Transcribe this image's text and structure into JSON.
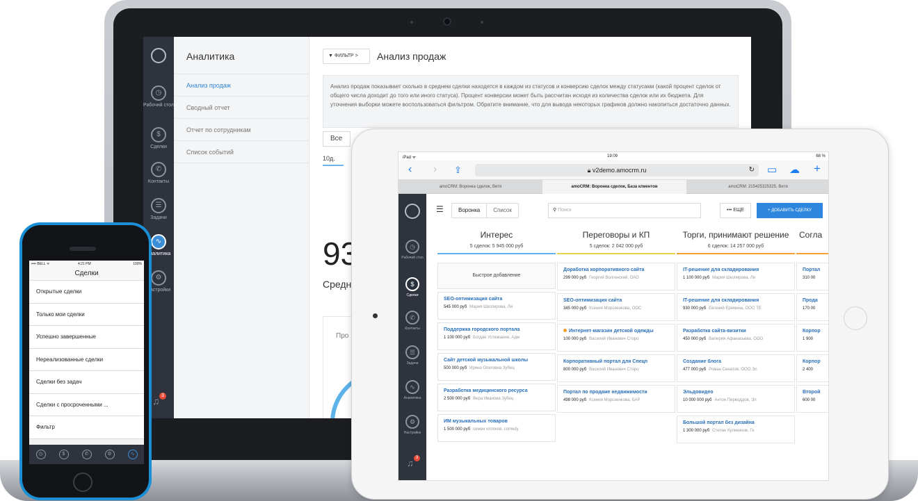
{
  "laptop": {
    "nav": {
      "items": [
        {
          "label": "Рабочий стол",
          "icon": "dashboard-icon"
        },
        {
          "label": "Сделки",
          "icon": "dollar-icon"
        },
        {
          "label": "Контакты",
          "icon": "phone-icon"
        },
        {
          "label": "Задачи",
          "icon": "tasks-icon"
        },
        {
          "label": "Аналитика",
          "icon": "analytics-icon"
        },
        {
          "label": "Настройки",
          "icon": "gear-icon"
        }
      ],
      "badge": "3"
    },
    "sidebar": {
      "title": "Аналитика",
      "items": [
        "Анализ продаж",
        "Сводный отчет",
        "Отчет по сотрудникам",
        "Список событий"
      ]
    },
    "main": {
      "filter_label": "ФИЛЬТР >",
      "title": "Анализ продаж",
      "description": "Анализ продаж показывает сколько в среднем сделки находятся в каждом из статусов и конверсию сделок между статусами (какой процент сделок от общего числа доходит до того или иного статуса). Процент конверсии может быть рассчитан исходя из количества сделок или их бюджета. Для уточнения выборки можете воспользоваться фильтром. Обратите внимание, что для вывода некоторых графиков должно накопиться достаточно данных.",
      "select_value": "Все",
      "tab": "10д.",
      "big_number": "93",
      "big_label": "Средн",
      "panel_label": "Про"
    }
  },
  "ipad": {
    "status": {
      "carrier": "iPad ᯤ",
      "time": "19:09",
      "battery": "68 %"
    },
    "url": "v2demo.amocrm.ru",
    "tabs": [
      "amoCRM: Воронка сделок, Витя",
      "amoCRM: Воронка сделок, База клиентов",
      "amoCRM: 215425325325, Витя"
    ],
    "nav": {
      "items": [
        {
          "label": "Рабочий стол",
          "icon": "dashboard-icon"
        },
        {
          "label": "Сделки",
          "icon": "dollar-icon"
        },
        {
          "label": "Контакты",
          "icon": "phone-icon"
        },
        {
          "label": "Задачи",
          "icon": "tasks-icon"
        },
        {
          "label": "Аналитика",
          "icon": "analytics-icon"
        },
        {
          "label": "Настройки",
          "icon": "gear-icon"
        }
      ],
      "badge": "3"
    },
    "toolbar": {
      "view_funnel": "Воронка",
      "view_list": "Список",
      "search_placeholder": "Поиск",
      "more": "ЕЩЕ",
      "add": "+ ДОБАВИТЬ СДЕЛКУ"
    },
    "quick_add": "Быстрое добавление",
    "columns": [
      {
        "title": "Интерес",
        "summary": "5 сделок: 5 945 000 руб",
        "color": "#5db2ea",
        "cards": [
          {
            "title": "SEO-оптимизация сайта",
            "price": "545 000 руб",
            "who": "Мария Шкопирова, Ли"
          },
          {
            "title": "Поддержка городского портала",
            "price": "1 100 000 руб",
            "who": "Богдан Устюжанин, Адм"
          },
          {
            "title": "Сайт детской музыкальной школы",
            "price": "500 000 руб",
            "who": "Ирина Олеговна Зубец"
          },
          {
            "title": "Разработка медицинского ресурса",
            "price": "2 500 000 руб",
            "who": "Вера Иванова Зубец"
          },
          {
            "title": "ИМ музыкальных товаров",
            "price": "1 500 000 руб",
            "who": "семен хлопков, comedy"
          }
        ]
      },
      {
        "title": "Переговоры и КП",
        "summary": "5 сделок: 2 042 000 руб",
        "color": "#e8d44a",
        "cards": [
          {
            "title": "Доработка корпоративного сайта",
            "price": "299 000 руб",
            "who": "Георгий Волгенский, ОАО"
          },
          {
            "title": "SEO-оптимизация сайта",
            "price": "345 000 руб",
            "who": "Ксения Морозенкова, ООС"
          },
          {
            "title": "Интернет-магазин детской одежды",
            "price": "100 000 руб",
            "who": "Василий Иванович Сторо",
            "dot": true
          },
          {
            "title": "Корпоративный портал для Спецп",
            "price": "800 000 руб",
            "who": "Василий Иванович Сторо"
          },
          {
            "title": "Портал по продаже недвижимости",
            "price": "498 000 руб",
            "who": "Ксения Морозенкова, БАР"
          }
        ]
      },
      {
        "title": "Торги, принимают решение",
        "summary": "6 сделок: 14 257 000 руб",
        "color": "#f0a030",
        "cards": [
          {
            "title": "IT-решение для складирования",
            "price": "1 100 000 руб",
            "who": "Мария Шкопирова, Ли"
          },
          {
            "title": "IT-решение для складирования",
            "price": "930 000 руб",
            "who": "Евгений Еремина, ООО ТЕ"
          },
          {
            "title": "Разработка сайта-визитки",
            "price": "450 000 руб",
            "who": "Валерия Афанасьева, ООО"
          },
          {
            "title": "Создание блога",
            "price": "477 000 руб",
            "who": "Роман Сенатов, ООО Эл"
          },
          {
            "title": "Эльдовидео",
            "price": "10 000 000 руб",
            "who": "Антон Перводдов, Эл"
          },
          {
            "title": "Большой портал без дизайна",
            "price": "1 300 000 руб",
            "who": "Степан Куликинов, Ге"
          }
        ]
      },
      {
        "title": "Согла",
        "summary": "",
        "color": "#f0a030",
        "cards": [
          {
            "title": "Портал",
            "price": "310 00",
            "who": ""
          },
          {
            "title": "Прода",
            "price": "170 00",
            "who": ""
          },
          {
            "title": "Корпор",
            "price": "1 900",
            "who": ""
          },
          {
            "title": "Корпор",
            "price": "2 400",
            "who": ""
          },
          {
            "title": "Второй",
            "price": "600 00",
            "who": ""
          }
        ]
      }
    ]
  },
  "iphone": {
    "status": {
      "carrier": "•••• BELL ᯤ",
      "time": "4:21 PM",
      "battery": "100%"
    },
    "title": "Сделки",
    "items": [
      "Открытые сделки",
      "Только мои сделки",
      "Успешно завершенные",
      "Нереализованные сделки",
      "Сделки без задач",
      "Сделки с просроченными ...",
      "Фильтр"
    ]
  }
}
